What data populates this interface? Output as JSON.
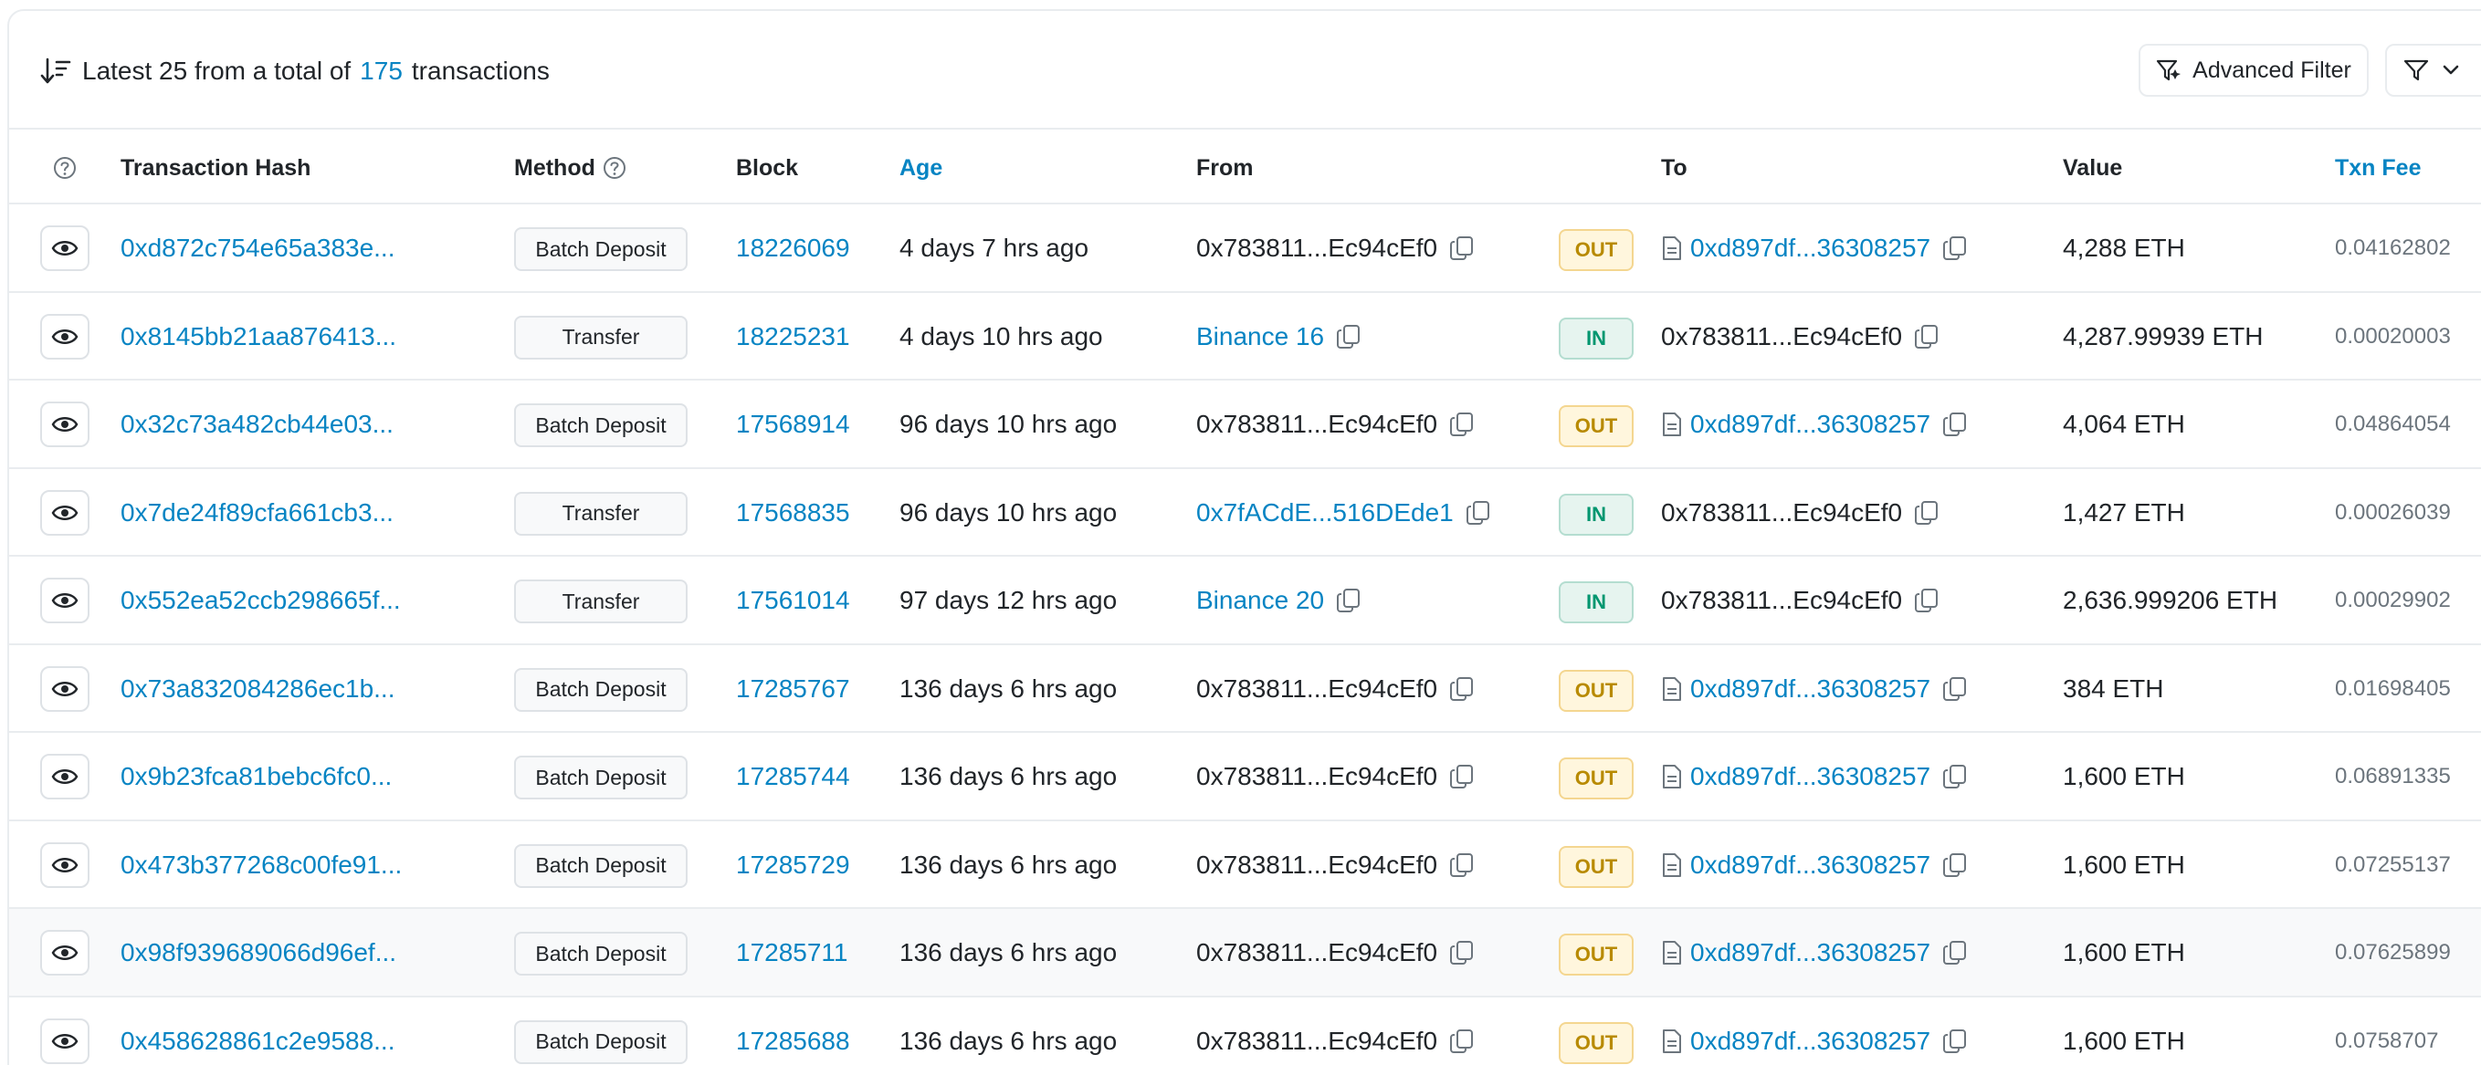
{
  "header": {
    "summary_prefix": "Latest 25 from a total of",
    "total": "175",
    "summary_suffix": "transactions",
    "advanced_filter_label": "Advanced Filter"
  },
  "columns": {
    "hash": "Transaction Hash",
    "method": "Method",
    "block": "Block",
    "age": "Age",
    "from": "From",
    "to": "To",
    "value": "Value",
    "fee": "Txn Fee"
  },
  "colors": {
    "link": "#0784c3",
    "out_bg": "#fff6dd",
    "out_text": "#b88a00",
    "in_bg": "#e6f4ef",
    "in_text": "#00966f"
  },
  "rows": [
    {
      "hash": "0xd872c754e65a383e...",
      "method": "Batch Deposit",
      "block": "18226069",
      "age": "4 days 7 hrs ago",
      "from": "0x783811...Ec94cEf0",
      "from_link": false,
      "dir": "OUT",
      "to": "0xd897df...36308257",
      "to_contract": true,
      "value": "4,288 ETH",
      "fee": "0.04162802"
    },
    {
      "hash": "0x8145bb21aa876413...",
      "method": "Transfer",
      "block": "18225231",
      "age": "4 days 10 hrs ago",
      "from": "Binance 16",
      "from_link": true,
      "dir": "IN",
      "to": "0x783811...Ec94cEf0",
      "to_contract": false,
      "value": "4,287.99939 ETH",
      "fee": "0.00020003"
    },
    {
      "hash": "0x32c73a482cb44e03...",
      "method": "Batch Deposit",
      "block": "17568914",
      "age": "96 days 10 hrs ago",
      "from": "0x783811...Ec94cEf0",
      "from_link": false,
      "dir": "OUT",
      "to": "0xd897df...36308257",
      "to_contract": true,
      "value": "4,064 ETH",
      "fee": "0.04864054"
    },
    {
      "hash": "0x7de24f89cfa661cb3...",
      "method": "Transfer",
      "block": "17568835",
      "age": "96 days 10 hrs ago",
      "from": "0x7fACdE...516DEde1",
      "from_link": true,
      "dir": "IN",
      "to": "0x783811...Ec94cEf0",
      "to_contract": false,
      "value": "1,427 ETH",
      "fee": "0.00026039"
    },
    {
      "hash": "0x552ea52ccb298665f...",
      "method": "Transfer",
      "block": "17561014",
      "age": "97 days 12 hrs ago",
      "from": "Binance 20",
      "from_link": true,
      "dir": "IN",
      "to": "0x783811...Ec94cEf0",
      "to_contract": false,
      "value": "2,636.999206 ETH",
      "fee": "0.00029902"
    },
    {
      "hash": "0x73a832084286ec1b...",
      "method": "Batch Deposit",
      "block": "17285767",
      "age": "136 days 6 hrs ago",
      "from": "0x783811...Ec94cEf0",
      "from_link": false,
      "dir": "OUT",
      "to": "0xd897df...36308257",
      "to_contract": true,
      "value": "384 ETH",
      "fee": "0.01698405"
    },
    {
      "hash": "0x9b23fca81bebc6fc0...",
      "method": "Batch Deposit",
      "block": "17285744",
      "age": "136 days 6 hrs ago",
      "from": "0x783811...Ec94cEf0",
      "from_link": false,
      "dir": "OUT",
      "to": "0xd897df...36308257",
      "to_contract": true,
      "value": "1,600 ETH",
      "fee": "0.06891335"
    },
    {
      "hash": "0x473b377268c00fe91...",
      "method": "Batch Deposit",
      "block": "17285729",
      "age": "136 days 6 hrs ago",
      "from": "0x783811...Ec94cEf0",
      "from_link": false,
      "dir": "OUT",
      "to": "0xd897df...36308257",
      "to_contract": true,
      "value": "1,600 ETH",
      "fee": "0.07255137"
    },
    {
      "hash": "0x98f939689066d96ef...",
      "method": "Batch Deposit",
      "block": "17285711",
      "age": "136 days 6 hrs ago",
      "from": "0x783811...Ec94cEf0",
      "from_link": false,
      "dir": "OUT",
      "to": "0xd897df...36308257",
      "to_contract": true,
      "value": "1,600 ETH",
      "fee": "0.07625899",
      "hover": true
    },
    {
      "hash": "0x458628861c2e9588...",
      "method": "Batch Deposit",
      "block": "17285688",
      "age": "136 days 6 hrs ago",
      "from": "0x783811...Ec94cEf0",
      "from_link": false,
      "dir": "OUT",
      "to": "0xd897df...36308257",
      "to_contract": true,
      "value": "1,600 ETH",
      "fee": "0.0758707"
    }
  ]
}
